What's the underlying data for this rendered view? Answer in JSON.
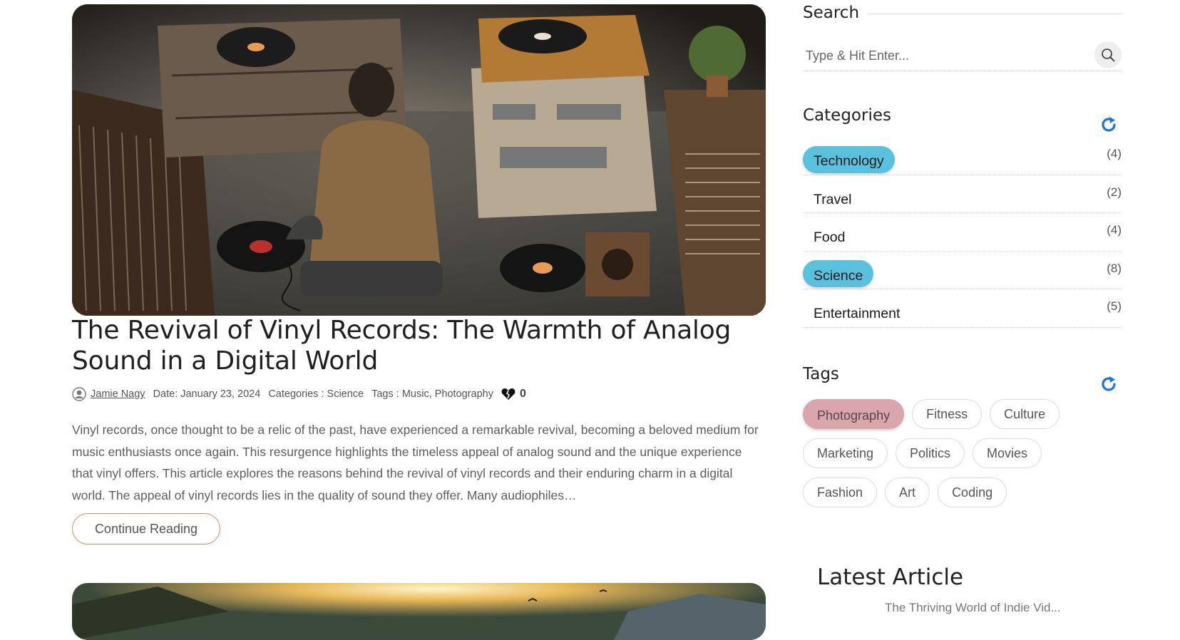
{
  "post": {
    "title": "The Revival of Vinyl Records: The Warmth of Analog Sound in a Digital World",
    "author": "Jamie Nagy",
    "date": "Date: January 23, 2024",
    "categories": "Categories : Science",
    "tags": "Tags : Music, Photography",
    "likes": "0",
    "excerpt": "Vinyl records, once thought to be a relic of the past, have experienced a remarkable revival, becoming a beloved medium for music enthusiasts once again. This resurgence highlights the timeless appeal of analog sound and the unique experience that vinyl offers. This article explores the reasons behind the revival of vinyl records and their enduring charm in a digital world. The appeal of vinyl records lies in the quality of sound they offer. Many audiophiles…",
    "continue_label": "Continue Reading"
  },
  "sidebar": {
    "search": {
      "title": "Search",
      "placeholder": "Type & Hit Enter..."
    },
    "categories": {
      "title": "Categories",
      "items": [
        {
          "name": "Technology",
          "count": "(4)",
          "active": true
        },
        {
          "name": "Travel",
          "count": "(2)",
          "active": false
        },
        {
          "name": "Food",
          "count": "(4)",
          "active": false
        },
        {
          "name": "Science",
          "count": "(8)",
          "active": true
        },
        {
          "name": "Entertainment",
          "count": "(5)",
          "active": false
        }
      ]
    },
    "tags": {
      "title": "Tags",
      "rows": [
        [
          {
            "name": "Photography",
            "active": true
          },
          {
            "name": "Fitness",
            "active": false
          },
          {
            "name": "Culture",
            "active": false
          }
        ],
        [
          {
            "name": "Marketing",
            "active": false
          },
          {
            "name": "Politics",
            "active": false
          },
          {
            "name": "Movies",
            "active": false
          }
        ],
        [
          {
            "name": "Fashion",
            "active": false
          },
          {
            "name": "Art",
            "active": false
          },
          {
            "name": "Coding",
            "active": false
          }
        ]
      ]
    },
    "latest": {
      "title": "Latest Article",
      "first_item_peek": "The Thriving World of Indie Vid..."
    }
  },
  "colors": {
    "category_active": "#5bc0de",
    "tag_active": "#d9a6ae",
    "continue_border": "#e0856b",
    "refresh_icon": "#1a73e8"
  }
}
